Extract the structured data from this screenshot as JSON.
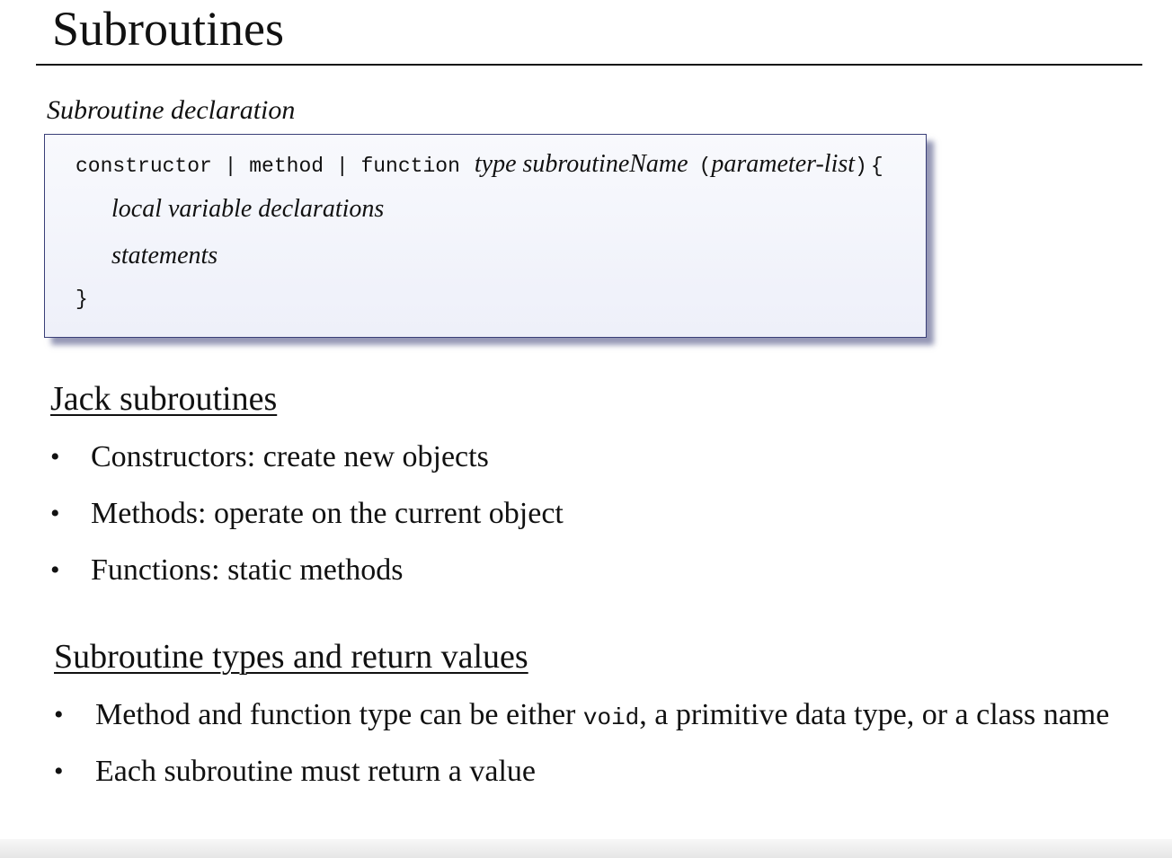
{
  "slide": {
    "title": "Subroutines"
  },
  "declaration": {
    "caption": "Subroutine declaration",
    "line1": {
      "keywords": "constructor | method | function",
      "signature": "type subroutineName",
      "open_paren": "(",
      "params": "parameter-list",
      "close_paren": ")",
      "brace": "{"
    },
    "line2": "local variable declarations",
    "line3": "statements",
    "line4": "}"
  },
  "jack_subroutines": {
    "heading": "Jack subroutines",
    "bullet_symbol": "•",
    "items": [
      "Constructors: create new objects",
      "Methods: operate on the current object",
      "Functions: static methods"
    ]
  },
  "types_section": {
    "heading": "Subroutine types and return values",
    "bullet_symbol": "•",
    "item1_prefix": "Method and function type can be either ",
    "item1_code": "void",
    "item1_suffix": ", a primitive data type, or a class name",
    "item2": "Each subroutine must return a value"
  }
}
